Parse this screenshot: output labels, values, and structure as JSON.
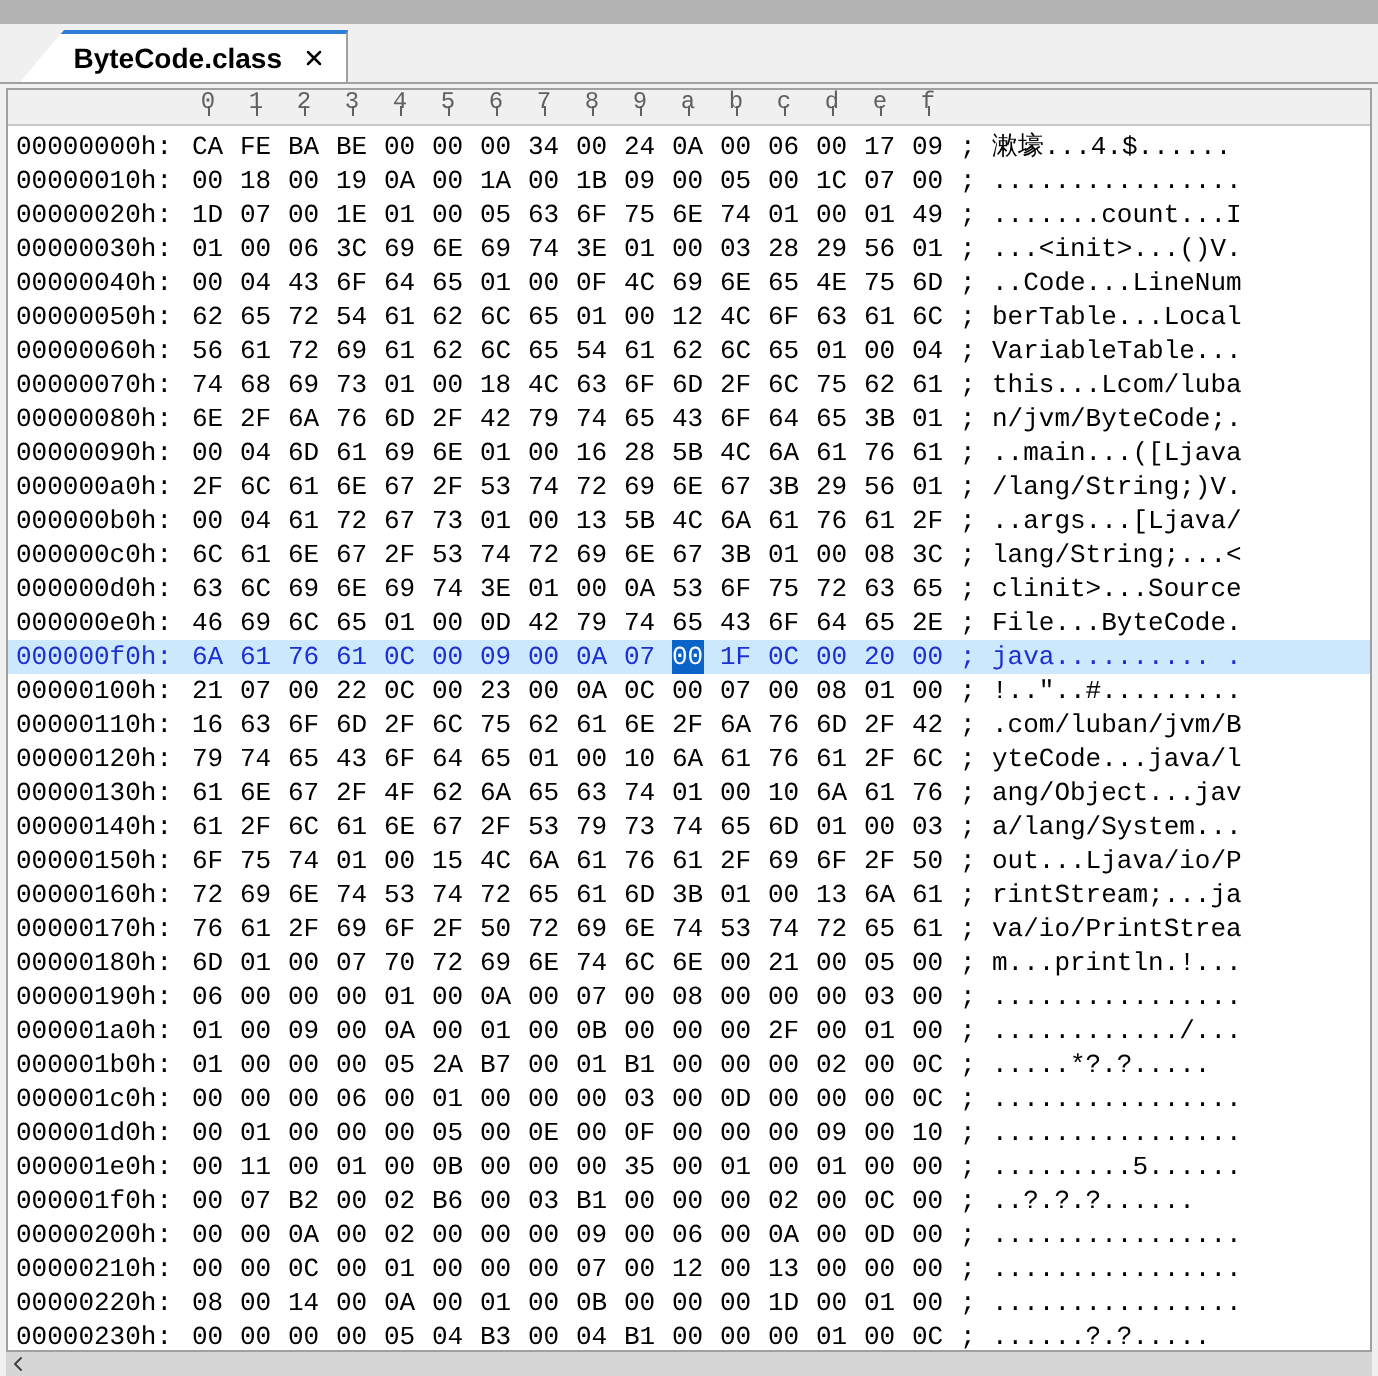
{
  "tabs": [
    {
      "label": "ByteCode.class",
      "selected": true
    }
  ],
  "columns": [
    "0",
    "1",
    "2",
    "3",
    "4",
    "5",
    "6",
    "7",
    "8",
    "9",
    "a",
    "b",
    "c",
    "d",
    "e",
    "f"
  ],
  "rows": [
    {
      "address": "00000000h:",
      "bytes": [
        "CA",
        "FE",
        "BA",
        "BE",
        "00",
        "00",
        "00",
        "34",
        "00",
        "24",
        "0A",
        "00",
        "06",
        "00",
        "17",
        "09"
      ],
      "separator": ";",
      "ascii": "漱壕...4.$......",
      "selected": false
    },
    {
      "address": "00000010h:",
      "bytes": [
        "00",
        "18",
        "00",
        "19",
        "0A",
        "00",
        "1A",
        "00",
        "1B",
        "09",
        "00",
        "05",
        "00",
        "1C",
        "07",
        "00"
      ],
      "separator": ";",
      "ascii": "................",
      "selected": false
    },
    {
      "address": "00000020h:",
      "bytes": [
        "1D",
        "07",
        "00",
        "1E",
        "01",
        "00",
        "05",
        "63",
        "6F",
        "75",
        "6E",
        "74",
        "01",
        "00",
        "01",
        "49"
      ],
      "separator": ";",
      "ascii": ".......count...I",
      "selected": false
    },
    {
      "address": "00000030h:",
      "bytes": [
        "01",
        "00",
        "06",
        "3C",
        "69",
        "6E",
        "69",
        "74",
        "3E",
        "01",
        "00",
        "03",
        "28",
        "29",
        "56",
        "01"
      ],
      "separator": ";",
      "ascii": "...<init>...()V.",
      "selected": false
    },
    {
      "address": "00000040h:",
      "bytes": [
        "00",
        "04",
        "43",
        "6F",
        "64",
        "65",
        "01",
        "00",
        "0F",
        "4C",
        "69",
        "6E",
        "65",
        "4E",
        "75",
        "6D"
      ],
      "separator": ";",
      "ascii": "..Code...LineNum",
      "selected": false
    },
    {
      "address": "00000050h:",
      "bytes": [
        "62",
        "65",
        "72",
        "54",
        "61",
        "62",
        "6C",
        "65",
        "01",
        "00",
        "12",
        "4C",
        "6F",
        "63",
        "61",
        "6C"
      ],
      "separator": ";",
      "ascii": "berTable...Local",
      "selected": false
    },
    {
      "address": "00000060h:",
      "bytes": [
        "56",
        "61",
        "72",
        "69",
        "61",
        "62",
        "6C",
        "65",
        "54",
        "61",
        "62",
        "6C",
        "65",
        "01",
        "00",
        "04"
      ],
      "separator": ";",
      "ascii": "VariableTable...",
      "selected": false
    },
    {
      "address": "00000070h:",
      "bytes": [
        "74",
        "68",
        "69",
        "73",
        "01",
        "00",
        "18",
        "4C",
        "63",
        "6F",
        "6D",
        "2F",
        "6C",
        "75",
        "62",
        "61"
      ],
      "separator": ";",
      "ascii": "this...Lcom/luba",
      "selected": false
    },
    {
      "address": "00000080h:",
      "bytes": [
        "6E",
        "2F",
        "6A",
        "76",
        "6D",
        "2F",
        "42",
        "79",
        "74",
        "65",
        "43",
        "6F",
        "64",
        "65",
        "3B",
        "01"
      ],
      "separator": ";",
      "ascii": "n/jvm/ByteCode;.",
      "selected": false
    },
    {
      "address": "00000090h:",
      "bytes": [
        "00",
        "04",
        "6D",
        "61",
        "69",
        "6E",
        "01",
        "00",
        "16",
        "28",
        "5B",
        "4C",
        "6A",
        "61",
        "76",
        "61"
      ],
      "separator": ";",
      "ascii": "..main...([Ljava",
      "selected": false
    },
    {
      "address": "000000a0h:",
      "bytes": [
        "2F",
        "6C",
        "61",
        "6E",
        "67",
        "2F",
        "53",
        "74",
        "72",
        "69",
        "6E",
        "67",
        "3B",
        "29",
        "56",
        "01"
      ],
      "separator": ";",
      "ascii": "/lang/String;)V.",
      "selected": false
    },
    {
      "address": "000000b0h:",
      "bytes": [
        "00",
        "04",
        "61",
        "72",
        "67",
        "73",
        "01",
        "00",
        "13",
        "5B",
        "4C",
        "6A",
        "61",
        "76",
        "61",
        "2F"
      ],
      "separator": ";",
      "ascii": "..args...[Ljava/",
      "selected": false
    },
    {
      "address": "000000c0h:",
      "bytes": [
        "6C",
        "61",
        "6E",
        "67",
        "2F",
        "53",
        "74",
        "72",
        "69",
        "6E",
        "67",
        "3B",
        "01",
        "00",
        "08",
        "3C"
      ],
      "separator": ";",
      "ascii": "lang/String;...<",
      "selected": false
    },
    {
      "address": "000000d0h:",
      "bytes": [
        "63",
        "6C",
        "69",
        "6E",
        "69",
        "74",
        "3E",
        "01",
        "00",
        "0A",
        "53",
        "6F",
        "75",
        "72",
        "63",
        "65"
      ],
      "separator": ";",
      "ascii": "clinit>...Source",
      "selected": false
    },
    {
      "address": "000000e0h:",
      "bytes": [
        "46",
        "69",
        "6C",
        "65",
        "01",
        "00",
        "0D",
        "42",
        "79",
        "74",
        "65",
        "43",
        "6F",
        "64",
        "65",
        "2E"
      ],
      "separator": ";",
      "ascii": "File...ByteCode.",
      "selected": false
    },
    {
      "address": "000000f0h:",
      "bytes_before": [
        "6A",
        "61",
        "76",
        "61",
        "0C",
        "00",
        "09",
        "00",
        "0A",
        "07"
      ],
      "cursor_byte": "00",
      "bytes_after": [
        "1F",
        "0C",
        "00",
        "20",
        "00"
      ],
      "separator": ";",
      "ascii": "java.......... .",
      "selected": true
    },
    {
      "address": "00000100h:",
      "bytes": [
        "21",
        "07",
        "00",
        "22",
        "0C",
        "00",
        "23",
        "00",
        "0A",
        "0C",
        "00",
        "07",
        "00",
        "08",
        "01",
        "00"
      ],
      "separator": ";",
      "ascii": "!..\"..#.........",
      "selected": false
    },
    {
      "address": "00000110h:",
      "bytes": [
        "16",
        "63",
        "6F",
        "6D",
        "2F",
        "6C",
        "75",
        "62",
        "61",
        "6E",
        "2F",
        "6A",
        "76",
        "6D",
        "2F",
        "42"
      ],
      "separator": ";",
      "ascii": ".com/luban/jvm/B",
      "selected": false
    },
    {
      "address": "00000120h:",
      "bytes": [
        "79",
        "74",
        "65",
        "43",
        "6F",
        "64",
        "65",
        "01",
        "00",
        "10",
        "6A",
        "61",
        "76",
        "61",
        "2F",
        "6C"
      ],
      "separator": ";",
      "ascii": "yteCode...java/l",
      "selected": false
    },
    {
      "address": "00000130h:",
      "bytes": [
        "61",
        "6E",
        "67",
        "2F",
        "4F",
        "62",
        "6A",
        "65",
        "63",
        "74",
        "01",
        "00",
        "10",
        "6A",
        "61",
        "76"
      ],
      "separator": ";",
      "ascii": "ang/Object...jav",
      "selected": false
    },
    {
      "address": "00000140h:",
      "bytes": [
        "61",
        "2F",
        "6C",
        "61",
        "6E",
        "67",
        "2F",
        "53",
        "79",
        "73",
        "74",
        "65",
        "6D",
        "01",
        "00",
        "03"
      ],
      "separator": ";",
      "ascii": "a/lang/System...",
      "selected": false
    },
    {
      "address": "00000150h:",
      "bytes": [
        "6F",
        "75",
        "74",
        "01",
        "00",
        "15",
        "4C",
        "6A",
        "61",
        "76",
        "61",
        "2F",
        "69",
        "6F",
        "2F",
        "50"
      ],
      "separator": ";",
      "ascii": "out...Ljava/io/P",
      "selected": false
    },
    {
      "address": "00000160h:",
      "bytes": [
        "72",
        "69",
        "6E",
        "74",
        "53",
        "74",
        "72",
        "65",
        "61",
        "6D",
        "3B",
        "01",
        "00",
        "13",
        "6A",
        "61"
      ],
      "separator": ";",
      "ascii": "rintStream;...ja",
      "selected": false
    },
    {
      "address": "00000170h:",
      "bytes": [
        "76",
        "61",
        "2F",
        "69",
        "6F",
        "2F",
        "50",
        "72",
        "69",
        "6E",
        "74",
        "53",
        "74",
        "72",
        "65",
        "61"
      ],
      "separator": ";",
      "ascii": "va/io/PrintStrea",
      "selected": false
    },
    {
      "address": "00000180h:",
      "bytes": [
        "6D",
        "01",
        "00",
        "07",
        "70",
        "72",
        "69",
        "6E",
        "74",
        "6C",
        "6E",
        "00",
        "21",
        "00",
        "05",
        "00"
      ],
      "separator": ";",
      "ascii": "m...println.!...",
      "selected": false
    },
    {
      "address": "00000190h:",
      "bytes": [
        "06",
        "00",
        "00",
        "00",
        "01",
        "00",
        "0A",
        "00",
        "07",
        "00",
        "08",
        "00",
        "00",
        "00",
        "03",
        "00"
      ],
      "separator": ";",
      "ascii": "................",
      "selected": false
    },
    {
      "address": "000001a0h:",
      "bytes": [
        "01",
        "00",
        "09",
        "00",
        "0A",
        "00",
        "01",
        "00",
        "0B",
        "00",
        "00",
        "00",
        "2F",
        "00",
        "01",
        "00"
      ],
      "separator": ";",
      "ascii": "............/...",
      "selected": false
    },
    {
      "address": "000001b0h:",
      "bytes": [
        "01",
        "00",
        "00",
        "00",
        "05",
        "2A",
        "B7",
        "00",
        "01",
        "B1",
        "00",
        "00",
        "00",
        "02",
        "00",
        "0C"
      ],
      "separator": ";",
      "ascii": ".....*?.?.....",
      "selected": false
    },
    {
      "address": "000001c0h:",
      "bytes": [
        "00",
        "00",
        "00",
        "06",
        "00",
        "01",
        "00",
        "00",
        "00",
        "03",
        "00",
        "0D",
        "00",
        "00",
        "00",
        "0C"
      ],
      "separator": ";",
      "ascii": "................",
      "selected": false
    },
    {
      "address": "000001d0h:",
      "bytes": [
        "00",
        "01",
        "00",
        "00",
        "00",
        "05",
        "00",
        "0E",
        "00",
        "0F",
        "00",
        "00",
        "00",
        "09",
        "00",
        "10"
      ],
      "separator": ";",
      "ascii": "................",
      "selected": false
    },
    {
      "address": "000001e0h:",
      "bytes": [
        "00",
        "11",
        "00",
        "01",
        "00",
        "0B",
        "00",
        "00",
        "00",
        "35",
        "00",
        "01",
        "00",
        "01",
        "00",
        "00"
      ],
      "separator": ";",
      "ascii": ".........5......",
      "selected": false
    },
    {
      "address": "000001f0h:",
      "bytes": [
        "00",
        "07",
        "B2",
        "00",
        "02",
        "B6",
        "00",
        "03",
        "B1",
        "00",
        "00",
        "00",
        "02",
        "00",
        "0C",
        "00"
      ],
      "separator": ";",
      "ascii": "..?.?.?......",
      "selected": false
    },
    {
      "address": "00000200h:",
      "bytes": [
        "00",
        "00",
        "0A",
        "00",
        "02",
        "00",
        "00",
        "00",
        "09",
        "00",
        "06",
        "00",
        "0A",
        "00",
        "0D",
        "00"
      ],
      "separator": ";",
      "ascii": "................",
      "selected": false
    },
    {
      "address": "00000210h:",
      "bytes": [
        "00",
        "00",
        "0C",
        "00",
        "01",
        "00",
        "00",
        "00",
        "07",
        "00",
        "12",
        "00",
        "13",
        "00",
        "00",
        "00"
      ],
      "separator": ";",
      "ascii": "................",
      "selected": false
    },
    {
      "address": "00000220h:",
      "bytes": [
        "08",
        "00",
        "14",
        "00",
        "0A",
        "00",
        "01",
        "00",
        "0B",
        "00",
        "00",
        "00",
        "1D",
        "00",
        "01",
        "00"
      ],
      "separator": ";",
      "ascii": "................",
      "selected": false
    },
    {
      "address": "00000230h:",
      "bytes": [
        "00",
        "00",
        "00",
        "00",
        "05",
        "04",
        "B3",
        "00",
        "04",
        "B1",
        "00",
        "00",
        "00",
        "01",
        "00",
        "0C"
      ],
      "separator": ";",
      "ascii": "......?.?.....",
      "selected": false
    }
  ]
}
